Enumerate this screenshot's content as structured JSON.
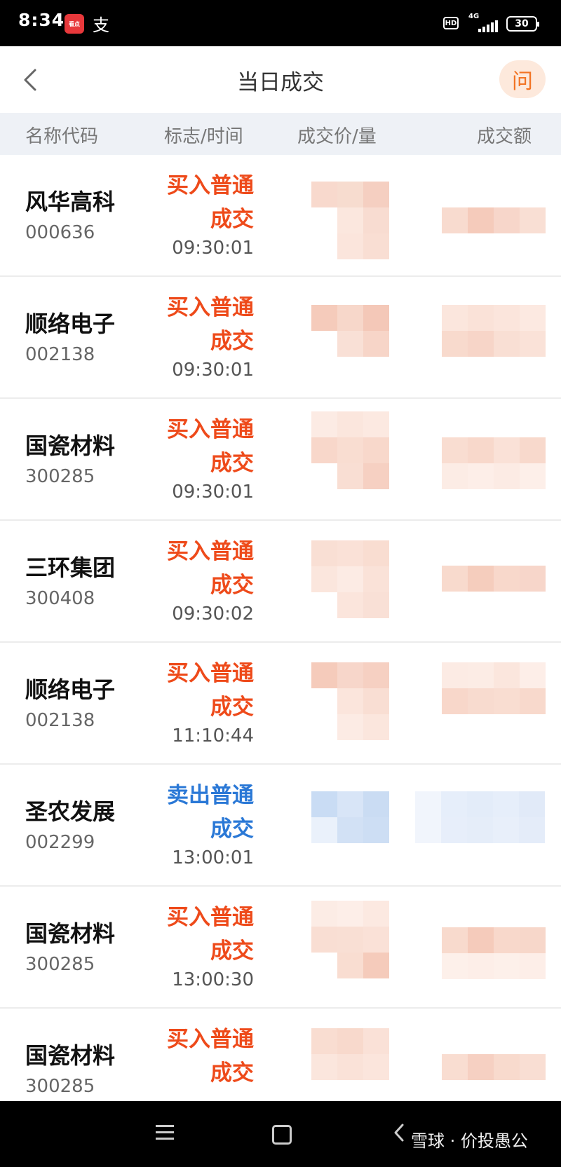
{
  "status_bar": {
    "time": "8:34",
    "app_badge": "看点",
    "alipay_glyph": "支",
    "hd": "HD",
    "network": "4G",
    "battery": "30"
  },
  "header": {
    "title": "当日成交",
    "ask_label": "问"
  },
  "columns": {
    "name_code": "名称代码",
    "flag_time": "标志/时间",
    "price_qty": "成交价/量",
    "amount": "成交额"
  },
  "trades": [
    {
      "name": "风华高科",
      "code": "000636",
      "flag_line1": "买入普通",
      "flag_line2": "成交",
      "time": "09:30:01",
      "side": "buy"
    },
    {
      "name": "顺络电子",
      "code": "002138",
      "flag_line1": "买入普通",
      "flag_line2": "成交",
      "time": "09:30:01",
      "side": "buy"
    },
    {
      "name": "国瓷材料",
      "code": "300285",
      "flag_line1": "买入普通",
      "flag_line2": "成交",
      "time": "09:30:01",
      "side": "buy"
    },
    {
      "name": "三环集团",
      "code": "300408",
      "flag_line1": "买入普通",
      "flag_line2": "成交",
      "time": "09:30:02",
      "side": "buy"
    },
    {
      "name": "顺络电子",
      "code": "002138",
      "flag_line1": "买入普通",
      "flag_line2": "成交",
      "time": "11:10:44",
      "side": "buy"
    },
    {
      "name": "圣农发展",
      "code": "002299",
      "flag_line1": "卖出普通",
      "flag_line2": "成交",
      "time": "13:00:01",
      "side": "sell"
    },
    {
      "name": "国瓷材料",
      "code": "300285",
      "flag_line1": "买入普通",
      "flag_line2": "成交",
      "time": "13:00:30",
      "side": "buy"
    },
    {
      "name": "国瓷材料",
      "code": "300285",
      "flag_line1": "买入普通",
      "flag_line2": "成交",
      "time": "",
      "side": "buy"
    }
  ],
  "colors": {
    "buy": "#ee4a1a",
    "sell": "#2a78d6",
    "accent": "#f27323"
  },
  "watermark": "雪球 · 价投愚公"
}
